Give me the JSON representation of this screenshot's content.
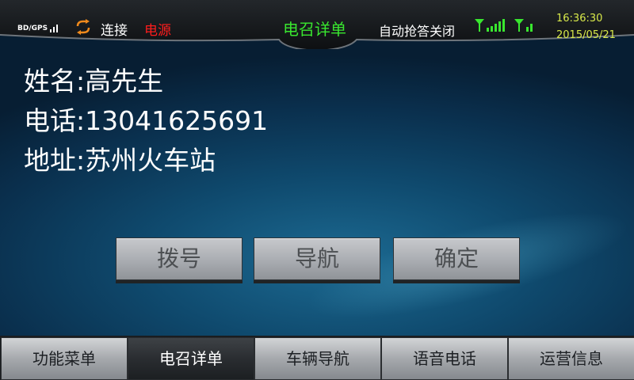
{
  "status_bar": {
    "gps_label": "BD/GPS",
    "connection_label": "连接",
    "power_label": "电源",
    "screen_title": "电召详单",
    "auto_answer_label": "自动抢答关闭",
    "time": "16:36:30",
    "date": "2015/05/21",
    "icons": [
      "gps-signal-icon",
      "sync-icon",
      "cell-signal-icon",
      "wifi-signal-icon"
    ],
    "colors": {
      "title": "#39e62f",
      "power": "#ff1d1d",
      "clock": "#d8e94a",
      "signal": "#39e62f"
    }
  },
  "details": {
    "name": "姓名:高先生",
    "phone": "电话:13041625691",
    "address": "地址:苏州火车站"
  },
  "actions": {
    "dial": "拨号",
    "navigate": "导航",
    "confirm": "确定"
  },
  "tabs": [
    {
      "label": "功能菜单",
      "active": false
    },
    {
      "label": "电召详单",
      "active": true
    },
    {
      "label": "车辆导航",
      "active": false
    },
    {
      "label": "语音电话",
      "active": false
    },
    {
      "label": "运营信息",
      "active": false
    }
  ]
}
